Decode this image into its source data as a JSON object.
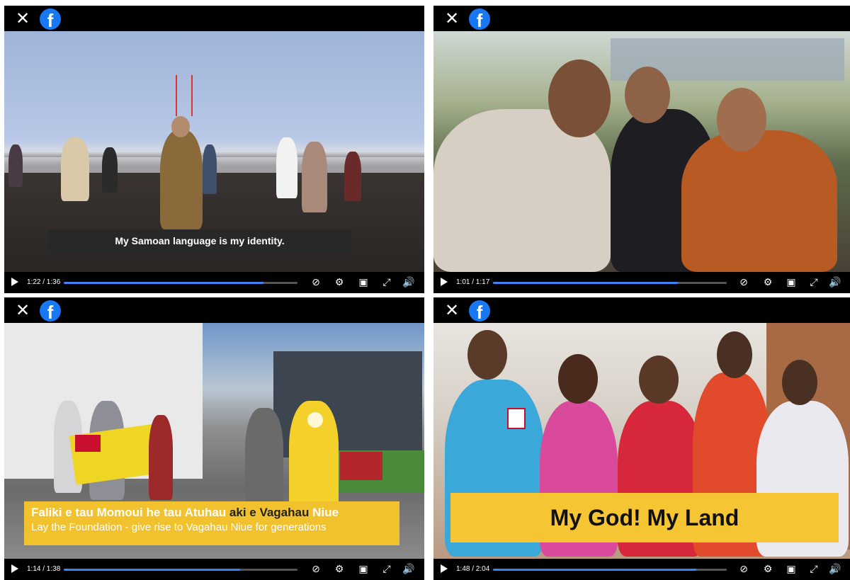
{
  "players": [
    {
      "close_glyph": "✕",
      "logo_letter": "f",
      "current_time": "1:22",
      "duration": "1:36",
      "time_display": "1:22 / 1:36",
      "progress": 0.854,
      "caption": "My Samoan language is my identity."
    },
    {
      "close_glyph": "✕",
      "logo_letter": "f",
      "current_time": "1:01",
      "duration": "1:17",
      "time_display": "1:01 / 1:17",
      "progress": 0.792
    },
    {
      "close_glyph": "✕",
      "logo_letter": "f",
      "current_time": "1:14",
      "duration": "1:38",
      "time_display": "1:14 / 1:38",
      "progress": 0.755,
      "caption_line1_white": "Faliki e tau Momoui he tau Atuhau",
      "caption_line1_dark": "aki e Vagahau",
      "caption_line1_end": "Niue",
      "caption_line2": "Lay the Foundation - give rise to Vagahau Niue for generations"
    },
    {
      "close_glyph": "✕",
      "logo_letter": "f",
      "current_time": "1:48",
      "duration": "2:04",
      "time_display": "1:48 / 2:04",
      "progress": 0.871,
      "caption": "My God! My Land"
    }
  ],
  "controls": {
    "captions_icon": "captions-icon",
    "settings_icon": "gear-icon",
    "pip_icon": "picture-in-picture-icon",
    "fullscreen_icon": "fullscreen-icon",
    "volume_icon": "volume-icon"
  },
  "colors": {
    "progress": "#3b82f6",
    "facebook": "#1877f2",
    "caption_yellow": "#f2c12e"
  }
}
